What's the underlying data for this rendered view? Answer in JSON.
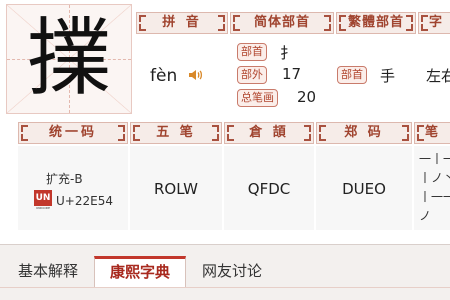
{
  "character": "擈",
  "headers": {
    "pinyin": "拼 音",
    "simplified_radical": "简体部首",
    "traditional_radical": "繁體部首",
    "partial_right": "字",
    "unicode": "统一码",
    "wubi": "五 笔",
    "cangjie": "倉 頡",
    "zhengma": "郑 码",
    "partial_right2": "笔"
  },
  "pinyin": {
    "reading": "fèn",
    "audio_icon": "speaker-icon"
  },
  "simplified": {
    "radical_tag": "部首",
    "radical_value": "扌",
    "outer_tag": "部外",
    "outer_value": "17",
    "total_tag": "总笔画",
    "total_value": "20"
  },
  "traditional": {
    "radical_tag": "部首",
    "radical_value": "手"
  },
  "partial_next_value": "左右",
  "unicode": {
    "block": "扩充-B",
    "logo_text": "UN",
    "logo_sub": "UNICODE",
    "code": "U+22E54"
  },
  "wubi_code": "ROLW",
  "cangjie_code": "QFDC",
  "zhengma_code": "DUEO",
  "stroke_preview": [
    "一丨一",
    "丨ノ丶",
    "丨一一",
    "ノ"
  ],
  "tabs": [
    {
      "label": "基本解释",
      "active": false
    },
    {
      "label": "康熙字典",
      "active": true
    },
    {
      "label": "网友讨论",
      "active": false
    }
  ],
  "colors": {
    "accent": "#a0442f",
    "tag_border": "#c97b6b",
    "active_tab": "#c2372b"
  }
}
